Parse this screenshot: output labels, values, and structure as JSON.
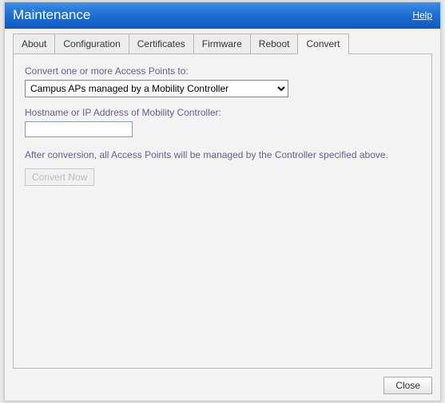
{
  "titlebar": {
    "title": "Maintenance",
    "help": "Help"
  },
  "tabs": [
    {
      "label": "About",
      "active": false
    },
    {
      "label": "Configuration",
      "active": false
    },
    {
      "label": "Certificates",
      "active": false
    },
    {
      "label": "Firmware",
      "active": false
    },
    {
      "label": "Reboot",
      "active": false
    },
    {
      "label": "Convert",
      "active": true
    }
  ],
  "form": {
    "convert_label": "Convert one or more Access Points to:",
    "convert_options": [
      "Campus APs managed by a Mobility Controller"
    ],
    "convert_selected": "Campus APs managed by a Mobility Controller",
    "hostname_label": "Hostname or IP Address of Mobility Controller:",
    "hostname_value": "",
    "note": "After conversion, all Access Points will be managed by the Controller specified above.",
    "convert_button": "Convert Now"
  },
  "footer": {
    "close": "Close"
  }
}
